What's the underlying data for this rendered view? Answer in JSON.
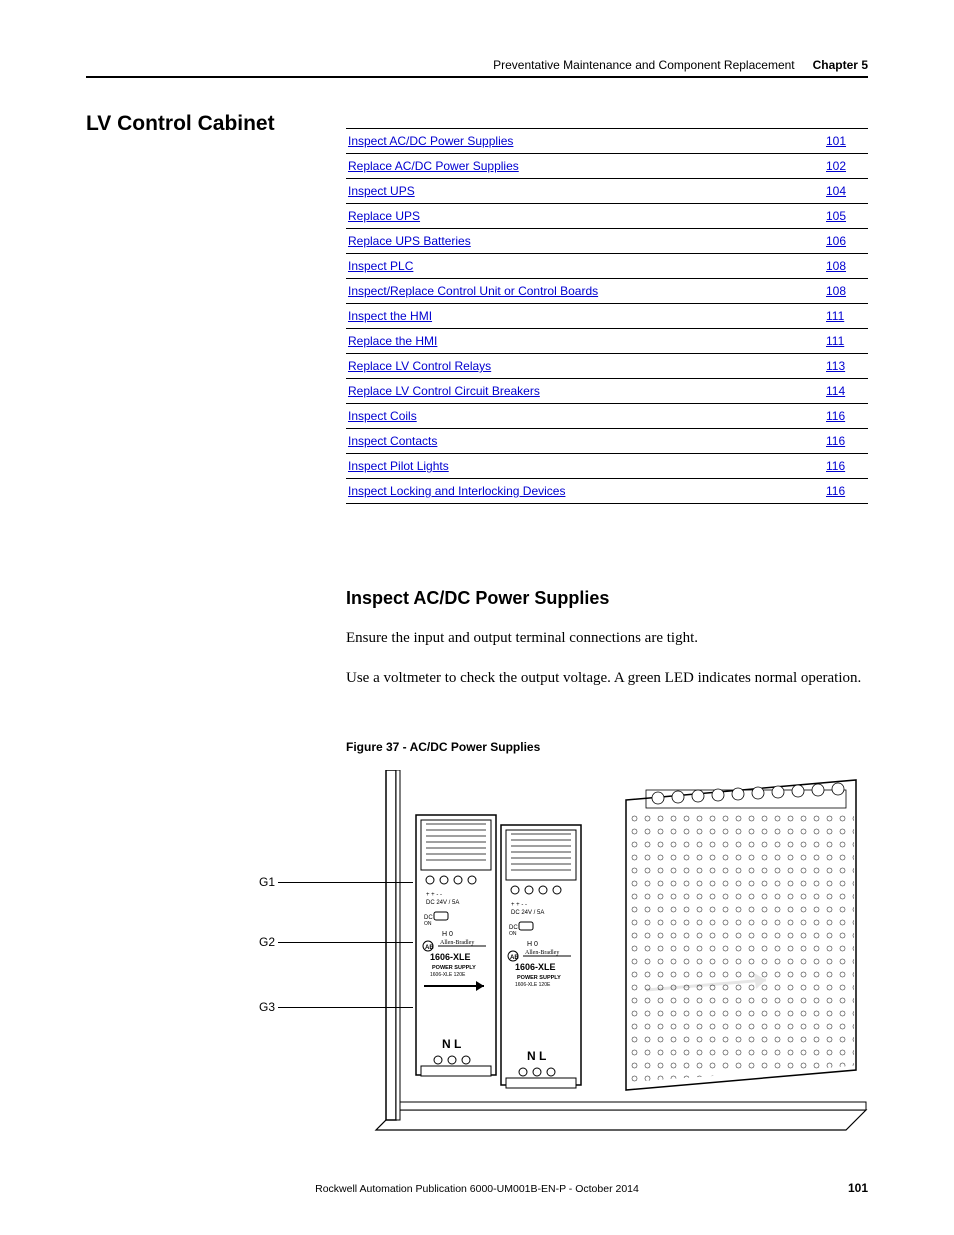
{
  "header": {
    "title": "Preventative Maintenance and Component Replacement",
    "chapter": "Chapter 5"
  },
  "section_title": "LV Control Cabinet",
  "toc": [
    {
      "label": "Inspect AC/DC Power Supplies",
      "page": "101"
    },
    {
      "label": "Replace AC/DC Power Supplies",
      "page": "102"
    },
    {
      "label": "Inspect UPS",
      "page": "104"
    },
    {
      "label": "Replace UPS",
      "page": "105"
    },
    {
      "label": "Replace UPS Batteries",
      "page": "106"
    },
    {
      "label": "Inspect PLC",
      "page": "108"
    },
    {
      "label": "Inspect/Replace Control Unit or Control Boards",
      "page": "108"
    },
    {
      "label": "Inspect the HMI",
      "page": "111"
    },
    {
      "label": "Replace the HMI",
      "page": "111"
    },
    {
      "label": "Replace LV Control Relays",
      "page": "113"
    },
    {
      "label": "Replace LV Control Circuit Breakers",
      "page": "114"
    },
    {
      "label": "Inspect Coils",
      "page": "116"
    },
    {
      "label": "Inspect Contacts",
      "page": "116"
    },
    {
      "label": "Inspect Pilot Lights",
      "page": "116"
    },
    {
      "label": "Inspect Locking and Interlocking Devices",
      "page": "116"
    }
  ],
  "subsection_title": "Inspect AC/DC Power Supplies",
  "paragraphs": {
    "p1": "Ensure the input and output terminal connections are tight.",
    "p2": "Use a voltmeter to check the output voltage. A green LED indicates normal operation."
  },
  "figure_caption": "Figure 37 - AC/DC Power Supplies",
  "callouts": {
    "g1": "G1",
    "g2": "G2",
    "g3": "G3"
  },
  "device_labels": {
    "brand": "Allen-Bradley",
    "model": "1606-XLE",
    "sub": "POWER SUPPLY",
    "nl": "N  L"
  },
  "footer": "Rockwell Automation Publication 6000-UM001B-EN-P - October 2014",
  "pagenum": "101"
}
